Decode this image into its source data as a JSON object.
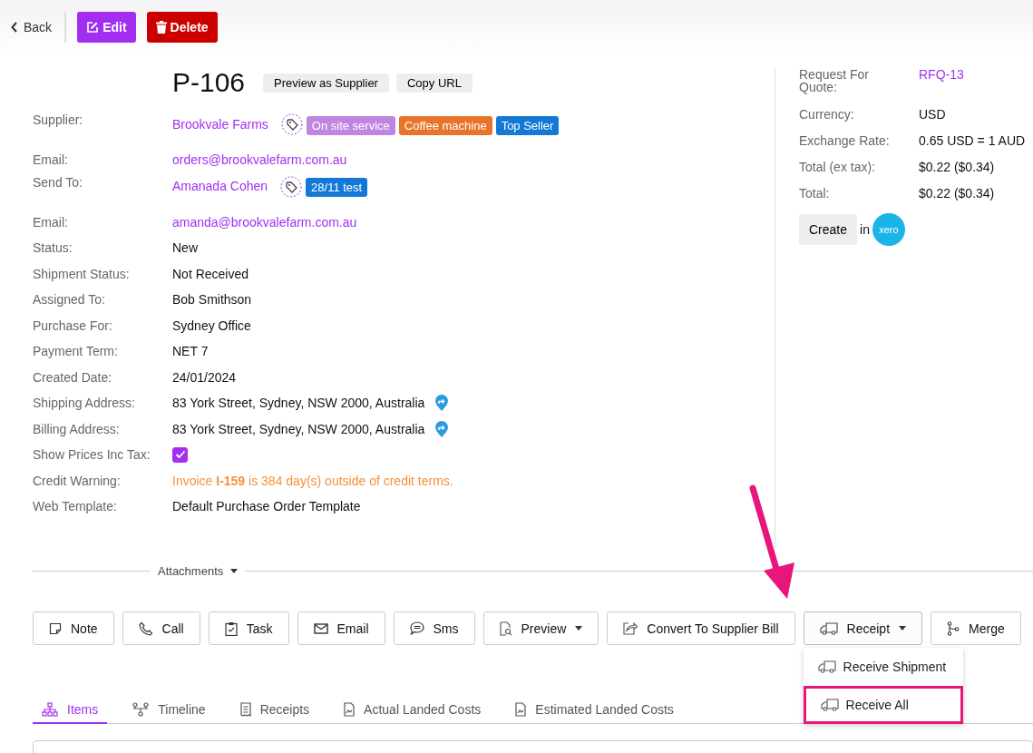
{
  "topbar": {
    "back": "Back",
    "edit": "Edit",
    "delete": "Delete"
  },
  "header": {
    "title": "P-106",
    "buttons": [
      "Preview as Supplier",
      "Copy URL"
    ]
  },
  "fields": [
    {
      "label": "Supplier:",
      "kind": "link",
      "value": "Brookvale Farms",
      "tags": [
        {
          "text": "On site service",
          "color": "#c085e0"
        },
        {
          "text": "Coffee machine",
          "color": "#e8742c"
        },
        {
          "text": "Top Seller",
          "color": "#1479d6"
        }
      ]
    },
    {
      "label": "Email:",
      "kind": "link",
      "value": "orders@brookvalefarm.com.au"
    },
    {
      "label": "Send To:",
      "kind": "link",
      "value": "Amanada Cohen",
      "tags": [
        {
          "text": "28/11 test",
          "color": "#1479d6"
        }
      ]
    },
    {
      "label": "Email:",
      "kind": "link",
      "value": "amanda@brookvalefarm.com.au"
    },
    {
      "label": "Status:",
      "kind": "text",
      "value": "New"
    },
    {
      "label": "Shipment Status:",
      "kind": "text",
      "value": "Not Received"
    },
    {
      "label": "Assigned To:",
      "kind": "text",
      "value": "Bob Smithson"
    },
    {
      "label": "Purchase For:",
      "kind": "text",
      "value": "Sydney Office"
    },
    {
      "label": "Payment Term:",
      "kind": "text",
      "value": "NET 7"
    },
    {
      "label": "Created Date:",
      "kind": "text",
      "value": "24/01/2024"
    },
    {
      "label": "Shipping Address:",
      "kind": "address",
      "value": "83 York Street, Sydney, NSW 2000, Australia"
    },
    {
      "label": "Billing Address:",
      "kind": "address",
      "value": "83 York Street, Sydney, NSW 2000, Australia"
    },
    {
      "label": "Show Prices Inc Tax:",
      "kind": "checkbox",
      "checked": true
    },
    {
      "label": "Credit Warning:",
      "kind": "warning",
      "value": "Invoice **I-159** is 384 day(s) outside of credit terms."
    },
    {
      "label": "Web Template:",
      "kind": "text",
      "value": "Default Purchase Order Template"
    }
  ],
  "summary": [
    {
      "label": "Request For Quote:",
      "kind": "link",
      "value": "RFQ-13"
    },
    {
      "label": "Currency:",
      "kind": "text",
      "value": "USD"
    },
    {
      "label": "Exchange Rate:",
      "kind": "text",
      "value": "0.65 USD = 1 AUD"
    },
    {
      "label": "Total (ex tax):",
      "kind": "text",
      "value": "$0.22 ($0.34)"
    },
    {
      "label": "Total:",
      "kind": "text",
      "value": "$0.22 ($0.34)"
    }
  ],
  "create": {
    "button": "Create",
    "connector": "in",
    "logo": "xero"
  },
  "attachments": "Attachments",
  "actions": [
    {
      "label": "Note",
      "kind": "note",
      "dropdown": false
    },
    {
      "label": "Call",
      "kind": "call",
      "dropdown": false
    },
    {
      "label": "Task",
      "kind": "task",
      "dropdown": false
    },
    {
      "label": "Email",
      "kind": "email",
      "dropdown": false
    },
    {
      "label": "Sms",
      "kind": "sms",
      "dropdown": false
    },
    {
      "label": "Preview",
      "kind": "preview",
      "dropdown": true
    },
    {
      "label": "Convert To Supplier Bill",
      "kind": "convert",
      "dropdown": false
    },
    {
      "label": "Receipt",
      "kind": "receipt",
      "dropdown": true,
      "expanded": true,
      "menu": [
        {
          "label": "Receive Shipment",
          "highlighted": false
        },
        {
          "label": "Receive All",
          "highlighted": true
        }
      ]
    },
    {
      "label": "Merge",
      "kind": "merge",
      "dropdown": false
    }
  ],
  "tabs": [
    {
      "label": "Items",
      "kind": "items",
      "selected": true
    },
    {
      "label": "Timeline",
      "kind": "timeline",
      "selected": false
    },
    {
      "label": "Receipts",
      "kind": "receipts",
      "selected": false
    },
    {
      "label": "Actual Landed Costs",
      "kind": "costs",
      "selected": false
    },
    {
      "label": "Estimated Landed Costs",
      "kind": "costs",
      "selected": false
    }
  ]
}
